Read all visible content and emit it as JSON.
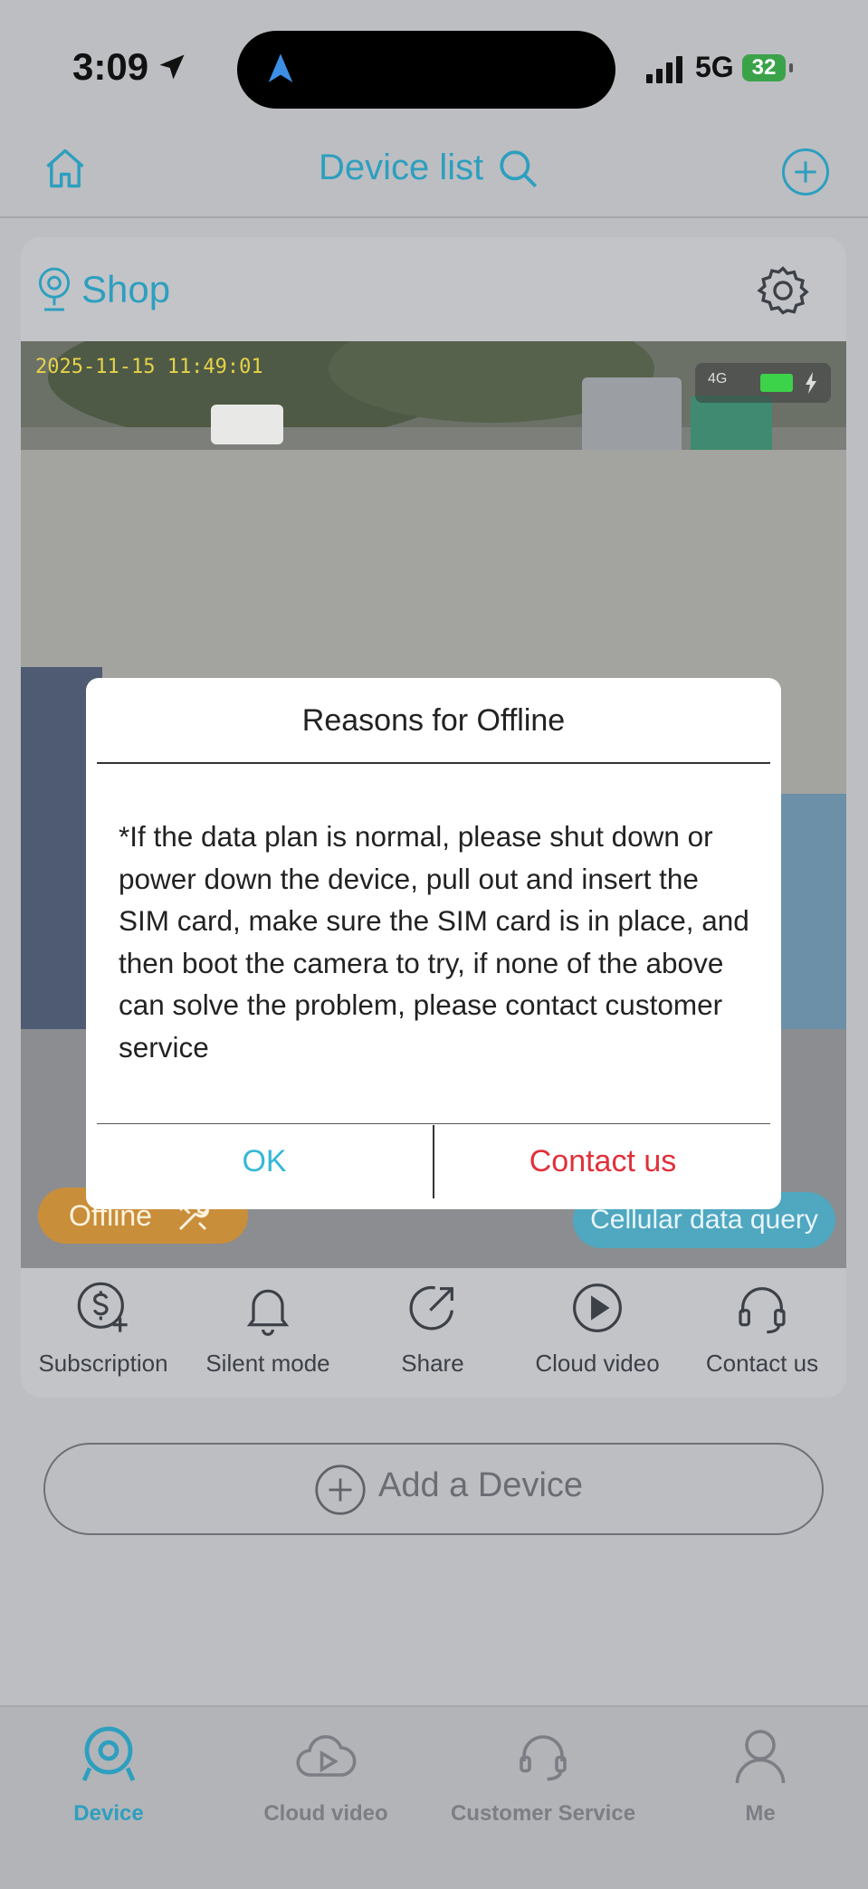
{
  "status_bar": {
    "time": "3:09",
    "network": "5G",
    "battery": "32"
  },
  "header": {
    "title": "Device list"
  },
  "device": {
    "name": "Shop",
    "timestamp": "2025-11-15 11:49:01",
    "camera_network": "4G",
    "offline_label": "Offline",
    "cellular_label": "Cellular data query"
  },
  "actions": [
    {
      "label": "Subscription",
      "icon": "dollar-plus-icon"
    },
    {
      "label": "Silent mode",
      "icon": "bell-icon"
    },
    {
      "label": "Share",
      "icon": "share-icon"
    },
    {
      "label": "Cloud video",
      "icon": "play-circle-icon"
    },
    {
      "label": "Contact us",
      "icon": "headset-icon"
    }
  ],
  "add_device": {
    "label": "Add a Device"
  },
  "nav": [
    {
      "label": "Device",
      "icon": "camera-icon",
      "active": true
    },
    {
      "label": "Cloud video",
      "icon": "cloud-play-icon",
      "active": false
    },
    {
      "label": "Customer Service",
      "icon": "headset-icon",
      "active": false
    },
    {
      "label": "Me",
      "icon": "user-icon",
      "active": false
    }
  ],
  "dialog": {
    "title": "Reasons for Offline",
    "body": "*If the data plan is normal, please shut down or power down the device, pull out and insert the SIM card, make sure the SIM card is in place, and then boot the camera to try, if none of the above can solve the problem, please contact customer service",
    "ok_label": "OK",
    "contact_label": "Contact us"
  },
  "colors": {
    "accent": "#2d9fbf",
    "danger": "#e0313a",
    "offline": "#c98e3a",
    "dialog_ok": "#35b8d6"
  }
}
